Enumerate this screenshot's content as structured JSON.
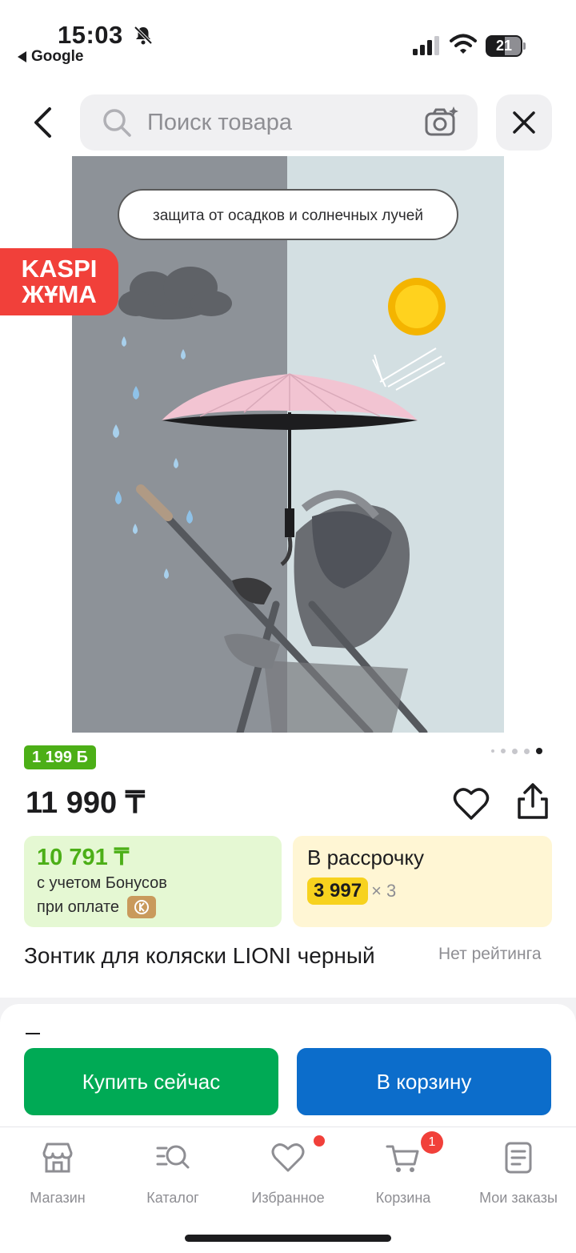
{
  "status_bar": {
    "time": "15:03",
    "back_app": "Google",
    "battery": "21"
  },
  "header": {
    "search_placeholder": "Поиск товара"
  },
  "image": {
    "caption": "защита от осадков и солнечных лучей",
    "promo_badge_line1": "KASPI",
    "promo_badge_line2": "ЖҰМА",
    "carousel_pages": 5,
    "carousel_active": 5
  },
  "product": {
    "bonus_points": "1 199 Ƃ",
    "price": "11 990 ₸",
    "bonus_price": "10 791 ₸",
    "bonus_line1": "с учетом Бонусов",
    "bonus_line2": "при оплате",
    "installment_title": "В рассрочку",
    "installment_amount": "3 997",
    "installment_times": "× 3",
    "title": "Зонтик для коляски LIONI черный",
    "rating": "Нет рейтинга"
  },
  "section": {
    "dash": "–"
  },
  "actions": {
    "buy_now": "Купить сейчас",
    "add_to_cart": "В корзину"
  },
  "tabbar": {
    "items": [
      {
        "label": "Магазин",
        "icon": "shop-icon"
      },
      {
        "label": "Каталог",
        "icon": "catalog-search-icon"
      },
      {
        "label": "Избранное",
        "icon": "heart-icon"
      },
      {
        "label": "Корзина",
        "icon": "cart-icon"
      },
      {
        "label": "Мои заказы",
        "icon": "orders-icon"
      }
    ],
    "cart_count": "1"
  },
  "colors": {
    "buy_button": "#00aa55",
    "cart_button": "#0c6dcb",
    "promo_red": "#f1403a",
    "bonus_green": "#4caf17",
    "installment_yellow": "#f7d21e"
  }
}
